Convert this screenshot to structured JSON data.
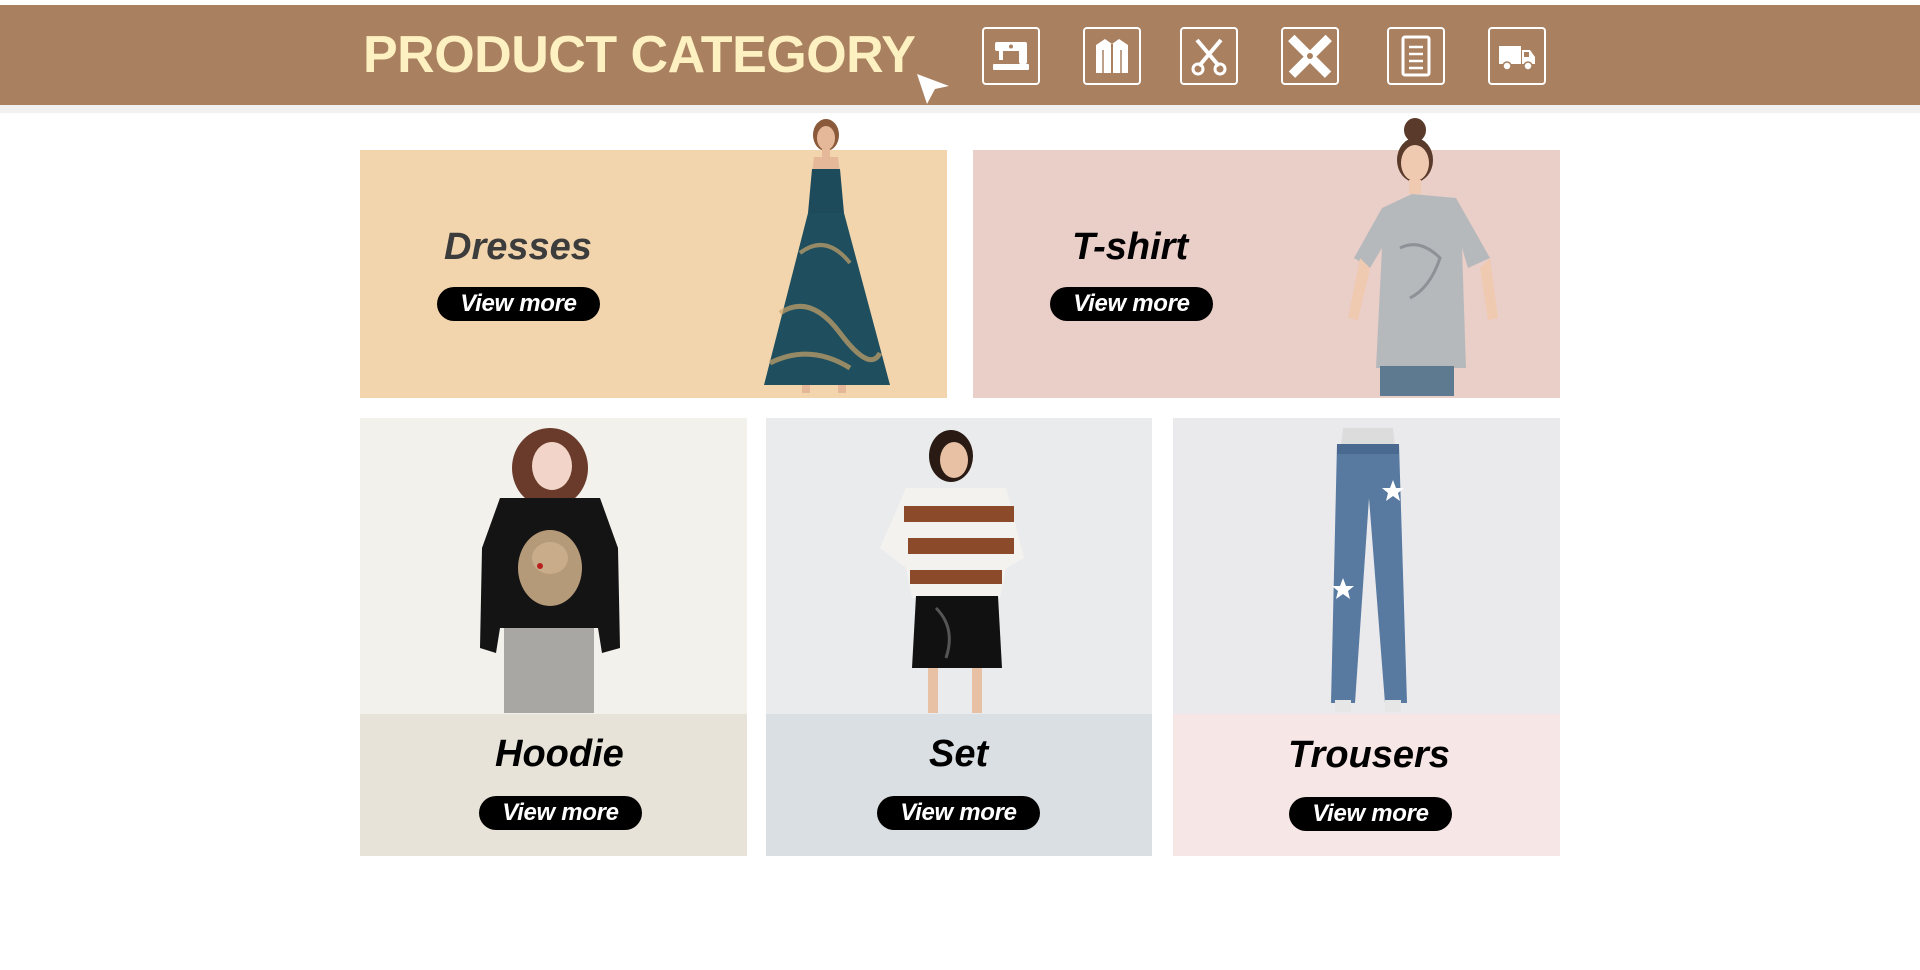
{
  "header": {
    "title": "PRODUCT CATEGORY",
    "icons": [
      "sewing-machine-icon",
      "jacket-icon",
      "scissors-icon",
      "ruler-pencil-icon",
      "document-icon",
      "delivery-truck-icon"
    ]
  },
  "colors": {
    "banner": "#a98060",
    "title": "#fdf0c1",
    "dresses_bg": "#f3d5ad",
    "tshirt_bg": "#eacec8",
    "hoodie_top": "#f3f1ec",
    "hoodie_bottom": "#e8e3d8",
    "set_top": "#e9ebed",
    "set_bottom": "#d9dfe3",
    "trousers_top": "#eaeaec",
    "trousers_bottom": "#f7e6e6"
  },
  "categories": {
    "dresses": {
      "title": "Dresses",
      "button": "View more"
    },
    "tshirt": {
      "title": "T-shirt",
      "button": "View more"
    },
    "hoodie": {
      "title": "Hoodie",
      "button": "View more"
    },
    "set": {
      "title": "Set",
      "button": "View more"
    },
    "trousers": {
      "title": "Trousers",
      "button": "View more"
    }
  }
}
